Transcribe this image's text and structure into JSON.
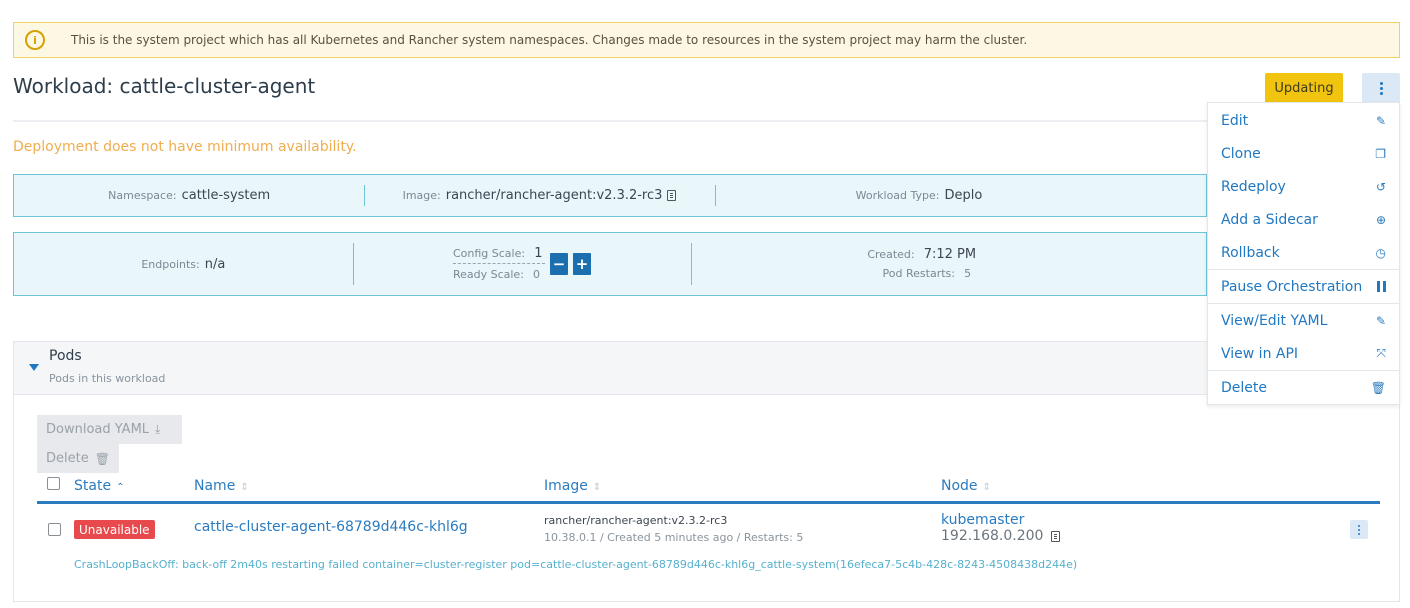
{
  "banner": {
    "icon": "info-circle-icon",
    "text": "This is the system project which has all Kubernetes and Rancher system namespaces. Changes made to resources in the system project may harm the cluster."
  },
  "header": {
    "title": "Workload: cattle-cluster-agent",
    "status_label": "Updating"
  },
  "warning": "Deployment does not have minimum availability.",
  "info_row1": {
    "namespace_label": "Namespace:",
    "namespace_value": "cattle-system",
    "image_label": "Image:",
    "image_value": "rancher/rancher-agent:v2.3.2-rc3",
    "type_label": "Workload Type:",
    "type_value": "Deplo"
  },
  "info_row2": {
    "endpoints_label": "Endpoints:",
    "endpoints_value": "n/a",
    "config_scale_label": "Config Scale:",
    "config_scale_value": "1",
    "ready_scale_label": "Ready Scale:",
    "ready_scale_value": "0",
    "decrement_label": "−",
    "increment_label": "+",
    "created_label": "Created:",
    "created_value": "7:12 PM",
    "restarts_label": "Pod Restarts:",
    "restarts_value": "5"
  },
  "menu": {
    "items": [
      {
        "label": "Edit",
        "icon": "pencil-icon"
      },
      {
        "label": "Clone",
        "icon": "copy-icon"
      },
      {
        "label": "Redeploy",
        "icon": "refresh-icon"
      },
      {
        "label": "Add a Sidecar",
        "icon": "plus-circle-icon"
      },
      {
        "label": "Rollback",
        "icon": "history-icon"
      },
      {
        "label": "Pause Orchestration",
        "icon": "pause-icon"
      },
      {
        "label": "View/Edit YAML",
        "icon": "pencil-icon"
      },
      {
        "label": "View in API",
        "icon": "external-link-icon"
      },
      {
        "label": "Delete",
        "icon": "trash-icon"
      }
    ]
  },
  "pods": {
    "title": "Pods",
    "subtitle": "Pods in this workload",
    "download_yaml_label": "Download YAML",
    "delete_label": "Delete",
    "columns": [
      "State",
      "Name",
      "Image",
      "Node"
    ],
    "rows": [
      {
        "state": "Unavailable",
        "name": "cattle-cluster-agent-68789d446c-khl6g",
        "image": "rancher/rancher-agent:v2.3.2-rc3",
        "image_detail": "10.38.0.1 / Created 5 minutes ago / Restarts: 5",
        "node": "kubemaster",
        "node_ip": "192.168.0.200",
        "message": "CrashLoopBackOff: back-off 2m40s restarting failed container=cluster-register pod=cattle-cluster-agent-68789d446c-khl6g_cattle-system(16efeca7-5c4b-428c-8243-4508438d244e)"
      }
    ]
  },
  "colors": {
    "accent": "#1f78c1",
    "warning": "#f0ad4e",
    "updating": "#f1c40f",
    "error": "#e8494d",
    "info_bg": "#e9f6fa",
    "info_border": "#6ec5d9"
  }
}
